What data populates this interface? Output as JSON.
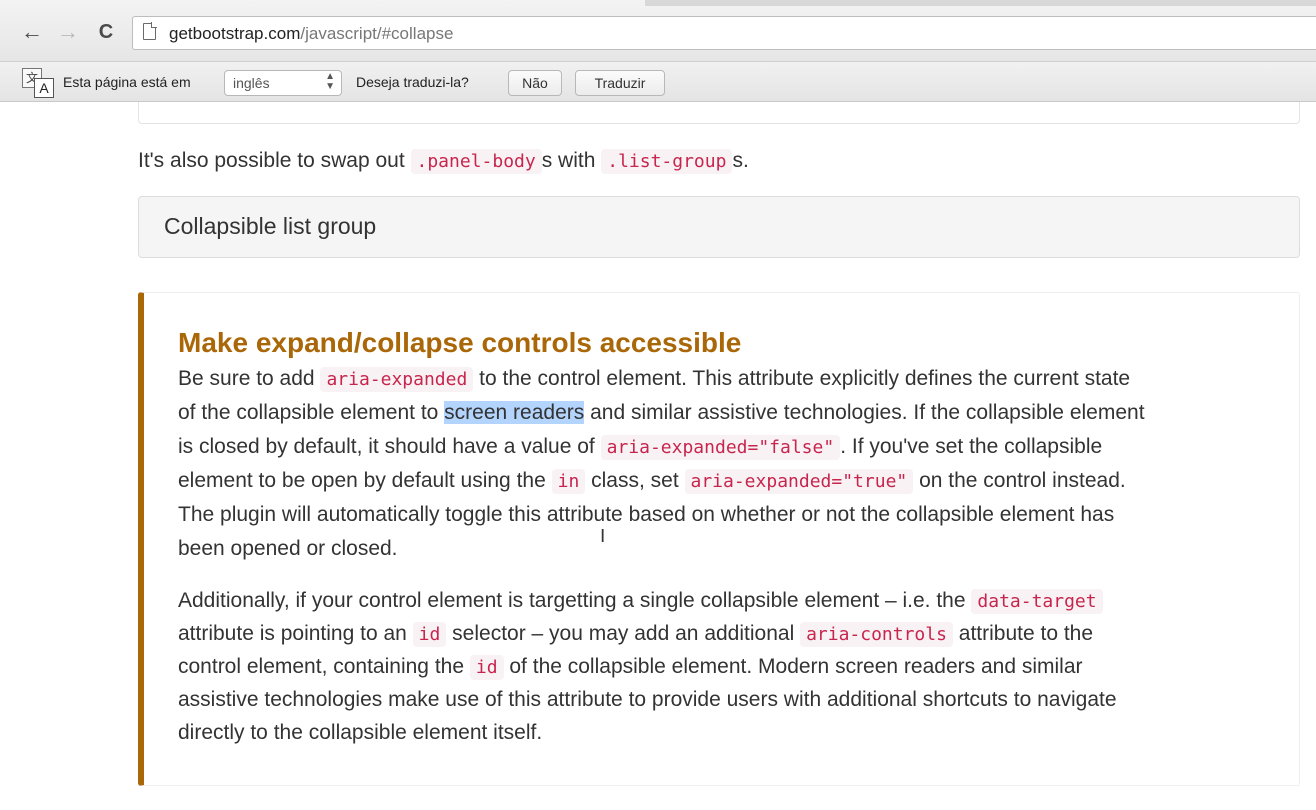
{
  "browser": {
    "url_host": "getbootstrap.com",
    "url_path": "/javascript/#collapse",
    "back_icon": "←",
    "forward_icon": "→",
    "reload_icon": "C"
  },
  "translate_bar": {
    "icon_glyph_1": "文",
    "icon_glyph_2": "A",
    "prefix": "Esta página está em",
    "language": "inglês",
    "question": "Deseja traduzi-la?",
    "no_label": "Não",
    "translate_label": "Traduzir"
  },
  "page": {
    "intro": {
      "t1": "It's also possible to swap out ",
      "c1": ".panel-body",
      "t2": "s with ",
      "c2": ".list-group",
      "t3": "s."
    },
    "panel_title": "Collapsible list group",
    "callout": {
      "title": "Make expand/collapse controls accessible",
      "p1": {
        "l1a": "Be sure to add ",
        "l1c": "aria-expanded",
        "l1b": " to the control element. This attribute explicitly defines the current state",
        "l2a": "of the collapsible element to ",
        "l2sel": "screen readers",
        "l2b": " and similar assistive technologies. If the collapsible element",
        "l3a": "is closed by default, it should have a value of ",
        "l3c": "aria-expanded=\"false\"",
        "l3b": ". If you've set the collapsible",
        "l4a": "element to be open by default using the ",
        "l4c1": "in",
        "l4b": " class, set ",
        "l4c2": "aria-expanded=\"true\"",
        "l4d": " on the control instead.",
        "l5": "The plugin will automatically toggle this attribute based on whether or not the collapsible element has",
        "l6": "been opened or closed."
      },
      "p2": {
        "l1a": "Additionally, if your control element is targetting a single collapsible element – i.e. the ",
        "l1c": "data-target",
        "l2a": "attribute is pointing to an ",
        "l2c1": "id",
        "l2b": " selector – you may add an additional ",
        "l2c2": "aria-controls",
        "l2d": " attribute to the",
        "l3a": "control element, containing the ",
        "l3c": "id",
        "l3b": " of the collapsible element. Modern screen readers and similar",
        "l4": "assistive technologies make use of this attribute to provide users with additional shortcuts to navigate",
        "l5": "directly to the collapsible element itself."
      }
    }
  },
  "colors": {
    "callout_accent": "#aa6708",
    "code_text": "#c7254e",
    "code_bg": "#f9f2f4",
    "selection": "#b3d4fc"
  }
}
